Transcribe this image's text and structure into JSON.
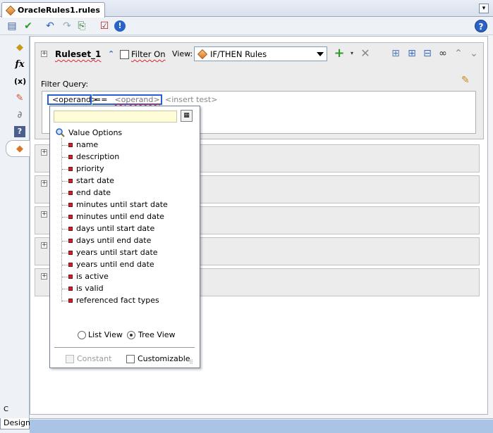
{
  "editor_tab": {
    "title": "OracleRules1.rules"
  },
  "toolbar": {
    "icons": [
      "dictionary-icon",
      "validate-check-icon",
      "undo-icon",
      "redo-icon",
      "export-icon",
      "test-icon",
      "info-icon"
    ],
    "help_icon": "?"
  },
  "left_strip": {
    "icons": [
      "facts-icon",
      "functions-icon",
      "globals-icon",
      "bucketsets-icon",
      "links-icon",
      "help-icon",
      "rulesets-icon"
    ],
    "fx_glyph": "fx",
    "x_glyph": "(x)",
    "bottom_char": "C"
  },
  "ruleset": {
    "name": "Ruleset_1",
    "filter_on_label": "Filter On",
    "view_label": "View:",
    "view_selected": "IF/THEN Rules",
    "filter_query_label": "Filter Query:",
    "query": {
      "left_operand": "<operand>",
      "operator": "==",
      "right_operand": "<operand>",
      "insert_test": "<insert test>"
    }
  },
  "rule_rows_count": 5,
  "popup": {
    "input_value": "",
    "root_label": "Value Options",
    "items": [
      "name",
      "description",
      "priority",
      "start date",
      "end date",
      "minutes until start date",
      "minutes until end date",
      "days until start date",
      "days until end date",
      "years until start date",
      "years until end date",
      "is active",
      "is valid",
      "referenced fact types"
    ],
    "list_view_label": "List View",
    "tree_view_label": "Tree View",
    "selected_view": "Tree View",
    "constant_label": "Constant",
    "constant_checked": false,
    "customizable_label": "Customizable",
    "customizable_checked": false
  },
  "bottom": {
    "design_tab": "Design"
  },
  "colors": {
    "accent": "#2660d4",
    "status_bar": "#a9c4e4",
    "bullet": "#c6252b"
  }
}
